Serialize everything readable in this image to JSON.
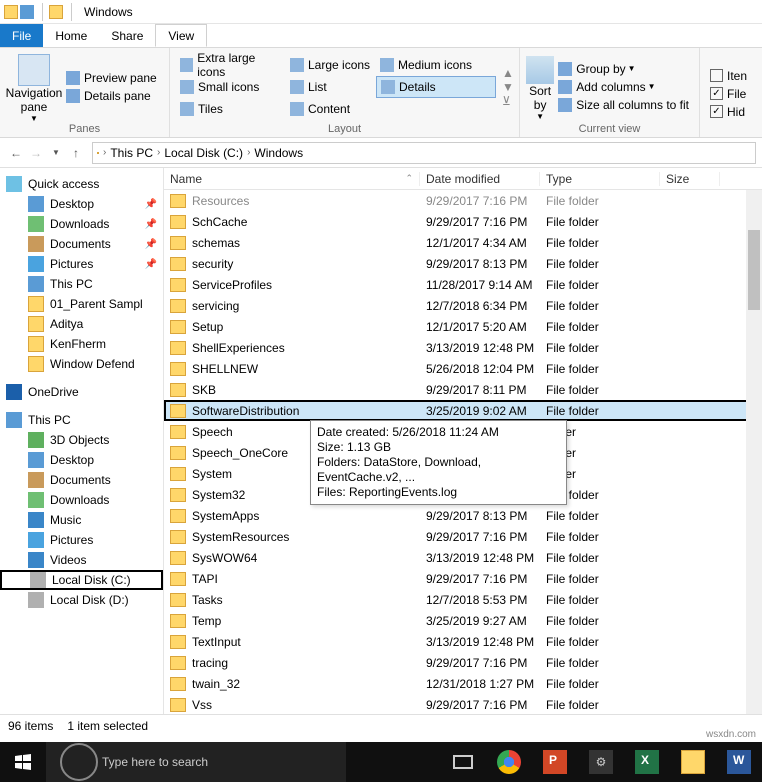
{
  "titlebar": {
    "title": "Windows"
  },
  "menu": {
    "file": "File",
    "home": "Home",
    "share": "Share",
    "view": "View"
  },
  "ribbon": {
    "panes": {
      "nav": "Navigation pane",
      "preview": "Preview pane",
      "details": "Details pane",
      "label": "Panes"
    },
    "layout": {
      "xl": "Extra large icons",
      "lg": "Large icons",
      "md": "Medium icons",
      "sm": "Small icons",
      "list": "List",
      "details": "Details",
      "tiles": "Tiles",
      "content": "Content",
      "label": "Layout"
    },
    "sort": {
      "sort": "Sort by",
      "group": "Group by",
      "addcols": "Add columns",
      "sizecols": "Size all columns to fit"
    },
    "currentview": "Current view",
    "show": {
      "item": "Iten",
      "file": "File",
      "hid": "Hid"
    }
  },
  "breadcrumbs": {
    "pc": "This PC",
    "c": "Local Disk (C:)",
    "win": "Windows"
  },
  "columns": {
    "name": "Name",
    "date": "Date modified",
    "type": "Type",
    "size": "Size"
  },
  "sidebar": {
    "quick": "Quick access",
    "desktop": "Desktop",
    "downloads": "Downloads",
    "documents": "Documents",
    "pictures": "Pictures",
    "thispc": "This PC",
    "parent": "01_Parent Sampl",
    "aditya": "Aditya",
    "ken": "KenFherm",
    "defend": "Window Defend",
    "onedrive": "OneDrive",
    "thispc2": "This PC",
    "obj3d": "3D Objects",
    "desktop2": "Desktop",
    "documents2": "Documents",
    "downloads2": "Downloads",
    "music": "Music",
    "pictures2": "Pictures",
    "videos": "Videos",
    "localc": "Local Disk (C:)",
    "locald": "Local Disk (D:)"
  },
  "rows": [
    {
      "name": "Resources",
      "date": "9/29/2017 7:16 PM",
      "type": "File folder"
    },
    {
      "name": "SchCache",
      "date": "9/29/2017 7:16 PM",
      "type": "File folder"
    },
    {
      "name": "schemas",
      "date": "12/1/2017 4:34 AM",
      "type": "File folder"
    },
    {
      "name": "security",
      "date": "9/29/2017 8:13 PM",
      "type": "File folder"
    },
    {
      "name": "ServiceProfiles",
      "date": "11/28/2017 9:14 AM",
      "type": "File folder"
    },
    {
      "name": "servicing",
      "date": "12/7/2018 6:34 PM",
      "type": "File folder"
    },
    {
      "name": "Setup",
      "date": "12/1/2017 5:20 AM",
      "type": "File folder"
    },
    {
      "name": "ShellExperiences",
      "date": "3/13/2019 12:48 PM",
      "type": "File folder"
    },
    {
      "name": "SHELLNEW",
      "date": "5/26/2018 12:04 PM",
      "type": "File folder"
    },
    {
      "name": "SKB",
      "date": "9/29/2017 8:11 PM",
      "type": "File folder"
    },
    {
      "name": "SoftwareDistribution",
      "date": "3/25/2019 9:02 AM",
      "type": "File folder",
      "selected": true,
      "boxed": true
    },
    {
      "name": "Speech",
      "date": "",
      "type": "folder"
    },
    {
      "name": "Speech_OneCore",
      "date": "",
      "type": "folder"
    },
    {
      "name": "System",
      "date": "",
      "type": "folder"
    },
    {
      "name": "System32",
      "date": "3/25/2019 8:59 AM",
      "type": "File folder"
    },
    {
      "name": "SystemApps",
      "date": "9/29/2017 8:13 PM",
      "type": "File folder"
    },
    {
      "name": "SystemResources",
      "date": "9/29/2017 7:16 PM",
      "type": "File folder"
    },
    {
      "name": "SysWOW64",
      "date": "3/13/2019 12:48 PM",
      "type": "File folder"
    },
    {
      "name": "TAPI",
      "date": "9/29/2017 7:16 PM",
      "type": "File folder"
    },
    {
      "name": "Tasks",
      "date": "12/7/2018 5:53 PM",
      "type": "File folder"
    },
    {
      "name": "Temp",
      "date": "3/25/2019 9:27 AM",
      "type": "File folder"
    },
    {
      "name": "TextInput",
      "date": "3/13/2019 12:48 PM",
      "type": "File folder"
    },
    {
      "name": "tracing",
      "date": "9/29/2017 7:16 PM",
      "type": "File folder"
    },
    {
      "name": "twain_32",
      "date": "12/31/2018 1:27 PM",
      "type": "File folder"
    },
    {
      "name": "Vss",
      "date": "9/29/2017 7:16 PM",
      "type": "File folder"
    }
  ],
  "tooltip": {
    "l1": "Date created: 5/26/2018 11:24 AM",
    "l2": "Size: 1.13 GB",
    "l3": "Folders: DataStore, Download, EventCache.v2, ...",
    "l4": "Files: ReportingEvents.log"
  },
  "status": {
    "items": "96 items",
    "sel": "1 item selected"
  },
  "taskbar": {
    "search": "Type here to search"
  },
  "watermark": "wsxdn.com"
}
